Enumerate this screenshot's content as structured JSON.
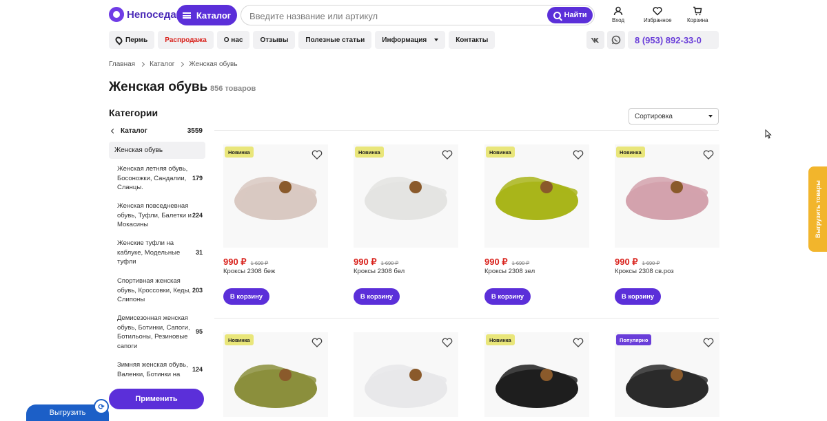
{
  "header": {
    "logo_text": "Непоседа",
    "catalog_label": "Каталог",
    "search_placeholder": "Введите название или артикул",
    "search_button": "Найти",
    "login": "Вход",
    "favorites": "Избранное",
    "cart": "Корзина"
  },
  "nav": {
    "city": "Пермь",
    "items": [
      "Распродажа",
      "О нас",
      "Отзывы",
      "Полезные статьи",
      "Информация",
      "Контакты"
    ],
    "social": [
      "vk-icon",
      "whatsapp-icon"
    ],
    "phone": "8 (953) 892-33-0"
  },
  "breadcrumbs": [
    "Главная",
    "Каталог",
    "Женская обувь"
  ],
  "page": {
    "title": "Женская обувь",
    "count": "856 товаров"
  },
  "sidebar": {
    "title": "Категории",
    "back_label": "Каталог",
    "back_count": "3559",
    "active": "Женская обувь",
    "subcategories": [
      {
        "label": "Женская летняя обувь, Босоножки, Сандалии, Сланцы.",
        "count": "179"
      },
      {
        "label": "Женская повседневная обувь, Туфли, Балетки и Мокасины",
        "count": "224"
      },
      {
        "label": "Женские туфли на каблуке, Модельные туфли",
        "count": "31"
      },
      {
        "label": "Спортивная женская обувь, Кроссовки, Кеды, Слипоны",
        "count": "203"
      },
      {
        "label": "Демисезонная женская обувь, Ботинки, Сапоги, Ботильоны, Резиновые сапоги",
        "count": "95"
      },
      {
        "label": "Зимняя женская обувь, Валенки, Ботинки на",
        "count": "124"
      }
    ],
    "apply_label": "Применить",
    "export_label": "Выгрузить"
  },
  "sort": {
    "label": "Сортировка"
  },
  "products": [
    {
      "badge": "Новинка",
      "badge_type": "new",
      "price": "990 ₽",
      "old_price": "1 690 ₽",
      "name": "Кроксы 2308 беж",
      "color": "#d9c9c2",
      "buy": "В корзину"
    },
    {
      "badge": "Новинка",
      "badge_type": "new",
      "price": "990 ₽",
      "old_price": "1 690 ₽",
      "name": "Кроксы 2308 бел",
      "color": "#e4e4e2",
      "buy": "В корзину"
    },
    {
      "badge": "Новинка",
      "badge_type": "new",
      "price": "990 ₽",
      "old_price": "1 690 ₽",
      "name": "Кроксы 2308 зел",
      "color": "#a9b51a",
      "buy": "В корзину"
    },
    {
      "badge": "Новинка",
      "badge_type": "new",
      "price": "990 ₽",
      "old_price": "1 690 ₽",
      "name": "Кроксы 2308 св.роз",
      "color": "#d3a2ad",
      "buy": "В корзину"
    },
    {
      "badge": "Новинка",
      "badge_type": "new",
      "color": "#8b8f3c"
    },
    {
      "badge": "",
      "badge_type": "none",
      "color": "#e8e8ea"
    },
    {
      "badge": "Новинка",
      "badge_type": "new",
      "color": "#1e1e1e"
    },
    {
      "badge": "Популярно",
      "badge_type": "pop",
      "color": "#2a2a2a"
    }
  ],
  "side_tab": "Выгрузить товары",
  "colors": {
    "accent": "#5b2fd9",
    "price": "#d9231d",
    "badge_new": "#e9e67a",
    "export": "#1c5fc7",
    "side_tab": "#f2b52c"
  }
}
